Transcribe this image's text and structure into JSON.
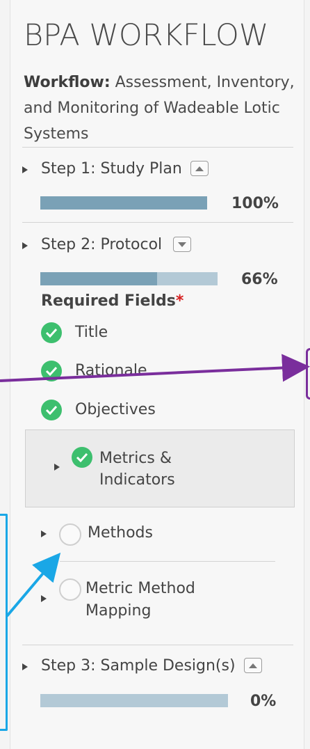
{
  "panel": {
    "title": "BPA WORKFLOW",
    "workflow_label": "Workflow:",
    "workflow_name": " Assessment, Inventory, and Monitoring of Wadeable Lotic Systems"
  },
  "steps": [
    {
      "label": "Step 1: Study Plan",
      "toggle": "up",
      "progress_pct": 100,
      "progress_text": "100%"
    },
    {
      "label": "Step 2: Protocol",
      "toggle": "down",
      "progress_pct": 66,
      "progress_text": "66%"
    },
    {
      "label": "Step 3: Sample Design(s)",
      "toggle": "up",
      "progress_pct": 0,
      "progress_text": "0%"
    }
  ],
  "required": {
    "label": "Required Fields",
    "star": "*",
    "fields": [
      {
        "label": "Title",
        "status": "complete"
      },
      {
        "label": "Rationale",
        "status": "complete"
      },
      {
        "label": "Objectives",
        "status": "complete"
      },
      {
        "label": "Metrics & Indicators",
        "status": "complete",
        "expandable": true,
        "highlighted": true
      },
      {
        "label": "Methods",
        "status": "incomplete",
        "expandable": true
      },
      {
        "label": "Metric Method Mapping",
        "status": "incomplete",
        "expandable": true
      }
    ]
  },
  "colors": {
    "check_green": "#3dbf6e",
    "bar_fill": "#7aa1b6",
    "bar_track": "#b3c9d6",
    "required_star": "#d62020",
    "annotation_blue": "#1aa7e6",
    "annotation_purple": "#7a2e9c"
  },
  "icons": {
    "expand": "triangle-right-icon",
    "collapse_toggle": "chevron-up-icon",
    "expand_toggle": "chevron-down-icon",
    "complete": "check-circle-icon",
    "incomplete": "empty-circle-icon"
  }
}
